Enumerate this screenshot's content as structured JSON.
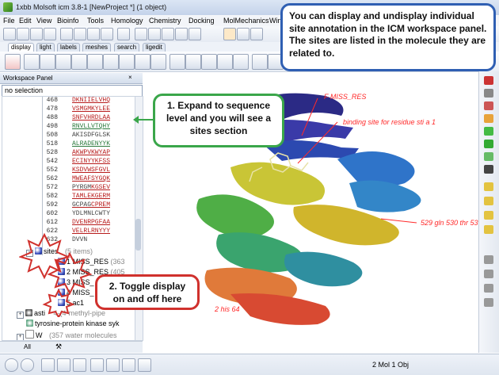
{
  "window": {
    "title": "1xbb Molsoft icm 3.8-1  [NewProject *] (1 object)"
  },
  "menu": [
    "File",
    "Edit",
    "View",
    "Bioinfo",
    "Tools",
    "Homology",
    "Chemistry",
    "Docking",
    "MolMechanics",
    "Win"
  ],
  "tabs": [
    "display",
    "light",
    "labels",
    "meshes",
    "search",
    "ligedit"
  ],
  "workspace": {
    "title": "Workspace Panel",
    "selection": "no selection",
    "sequence_rows": [
      {
        "num": "468",
        "seq": "DKNIIELVHQ",
        "style": "red"
      },
      {
        "num": "478",
        "seq": "VSMGMKYLEE",
        "style": "red"
      },
      {
        "num": "488",
        "seq": "SNFVHRDLAA",
        "style": "red"
      },
      {
        "num": "498",
        "seq": "RNVLLVTQHY",
        "style": "grn"
      },
      {
        "num": "508",
        "seq": "AKISDFGLSK",
        "style": "gry"
      },
      {
        "num": "518",
        "seq": "ALRADENYYK",
        "style": "grn"
      },
      {
        "num": "528",
        "seq": "AKWPVKWYAP",
        "style": "red"
      },
      {
        "num": "542",
        "seq": "ECINYYKFSS",
        "style": "red"
      },
      {
        "num": "552",
        "seq": "KSDVWSFGVL",
        "style": "red"
      },
      {
        "num": "562",
        "seq": "MWEAFSYGQK",
        "style": "red"
      },
      {
        "num": "572",
        "prefix": "PYRGM",
        "seq": "KGSEV",
        "style": "red"
      },
      {
        "num": "582",
        "seq": "TAMLEKGERM",
        "style": "red"
      },
      {
        "num": "592",
        "prefix": "GCPAG",
        "seq": "CPREM",
        "style": "red"
      },
      {
        "num": "602",
        "seq": "YDLMNLCWTY",
        "style": "gry"
      },
      {
        "num": "612",
        "seq": "DVENRPGFAA",
        "style": "red"
      },
      {
        "num": "622",
        "seq": "VELRLRNYYY",
        "style": "red"
      },
      {
        "num": "632",
        "seq": "DVVN",
        "style": "gry"
      }
    ],
    "sites_label": "sites",
    "sites_count": "(5 items)",
    "sites": [
      {
        "label": "1 MISS_RES",
        "extra": "(363"
      },
      {
        "label": "2 MISS_RES",
        "extra": "(405"
      },
      {
        "label": "3 MISS_",
        "extra": ""
      },
      {
        "label": "4 MISS_",
        "extra": ""
      },
      {
        "label": "5 ac1",
        "extra": ""
      }
    ],
    "asti_label": "asti",
    "asti_desc": "4-(4-methyl-pipe",
    "kinase_label": "tyrosine-protein kinase syk",
    "water_label": "W",
    "water_desc": "(357 water molecules",
    "bottom_tab": "All"
  },
  "callouts": {
    "top": "You can display and undisplay individual site annotation in the ICM workspace panel. The sites are listed in the molecule they are related to.",
    "expand": "1. Expand to sequence level and you will see a sites section",
    "toggle": "2. Toggle display on and off here"
  },
  "mol_labels": {
    "miss": "F MISS_RES",
    "binding": "binding site for residue sti a 1",
    "gln": "529 gln 530 thr 53",
    "his": "2 his 64"
  },
  "status": {
    "objects": "2 Mol 1 Obj"
  },
  "colors": {
    "blue_callout": "#2f5fb3",
    "green_callout": "#3aa64a",
    "red_callout": "#d0312d",
    "label_red": "#ff2a2a"
  }
}
